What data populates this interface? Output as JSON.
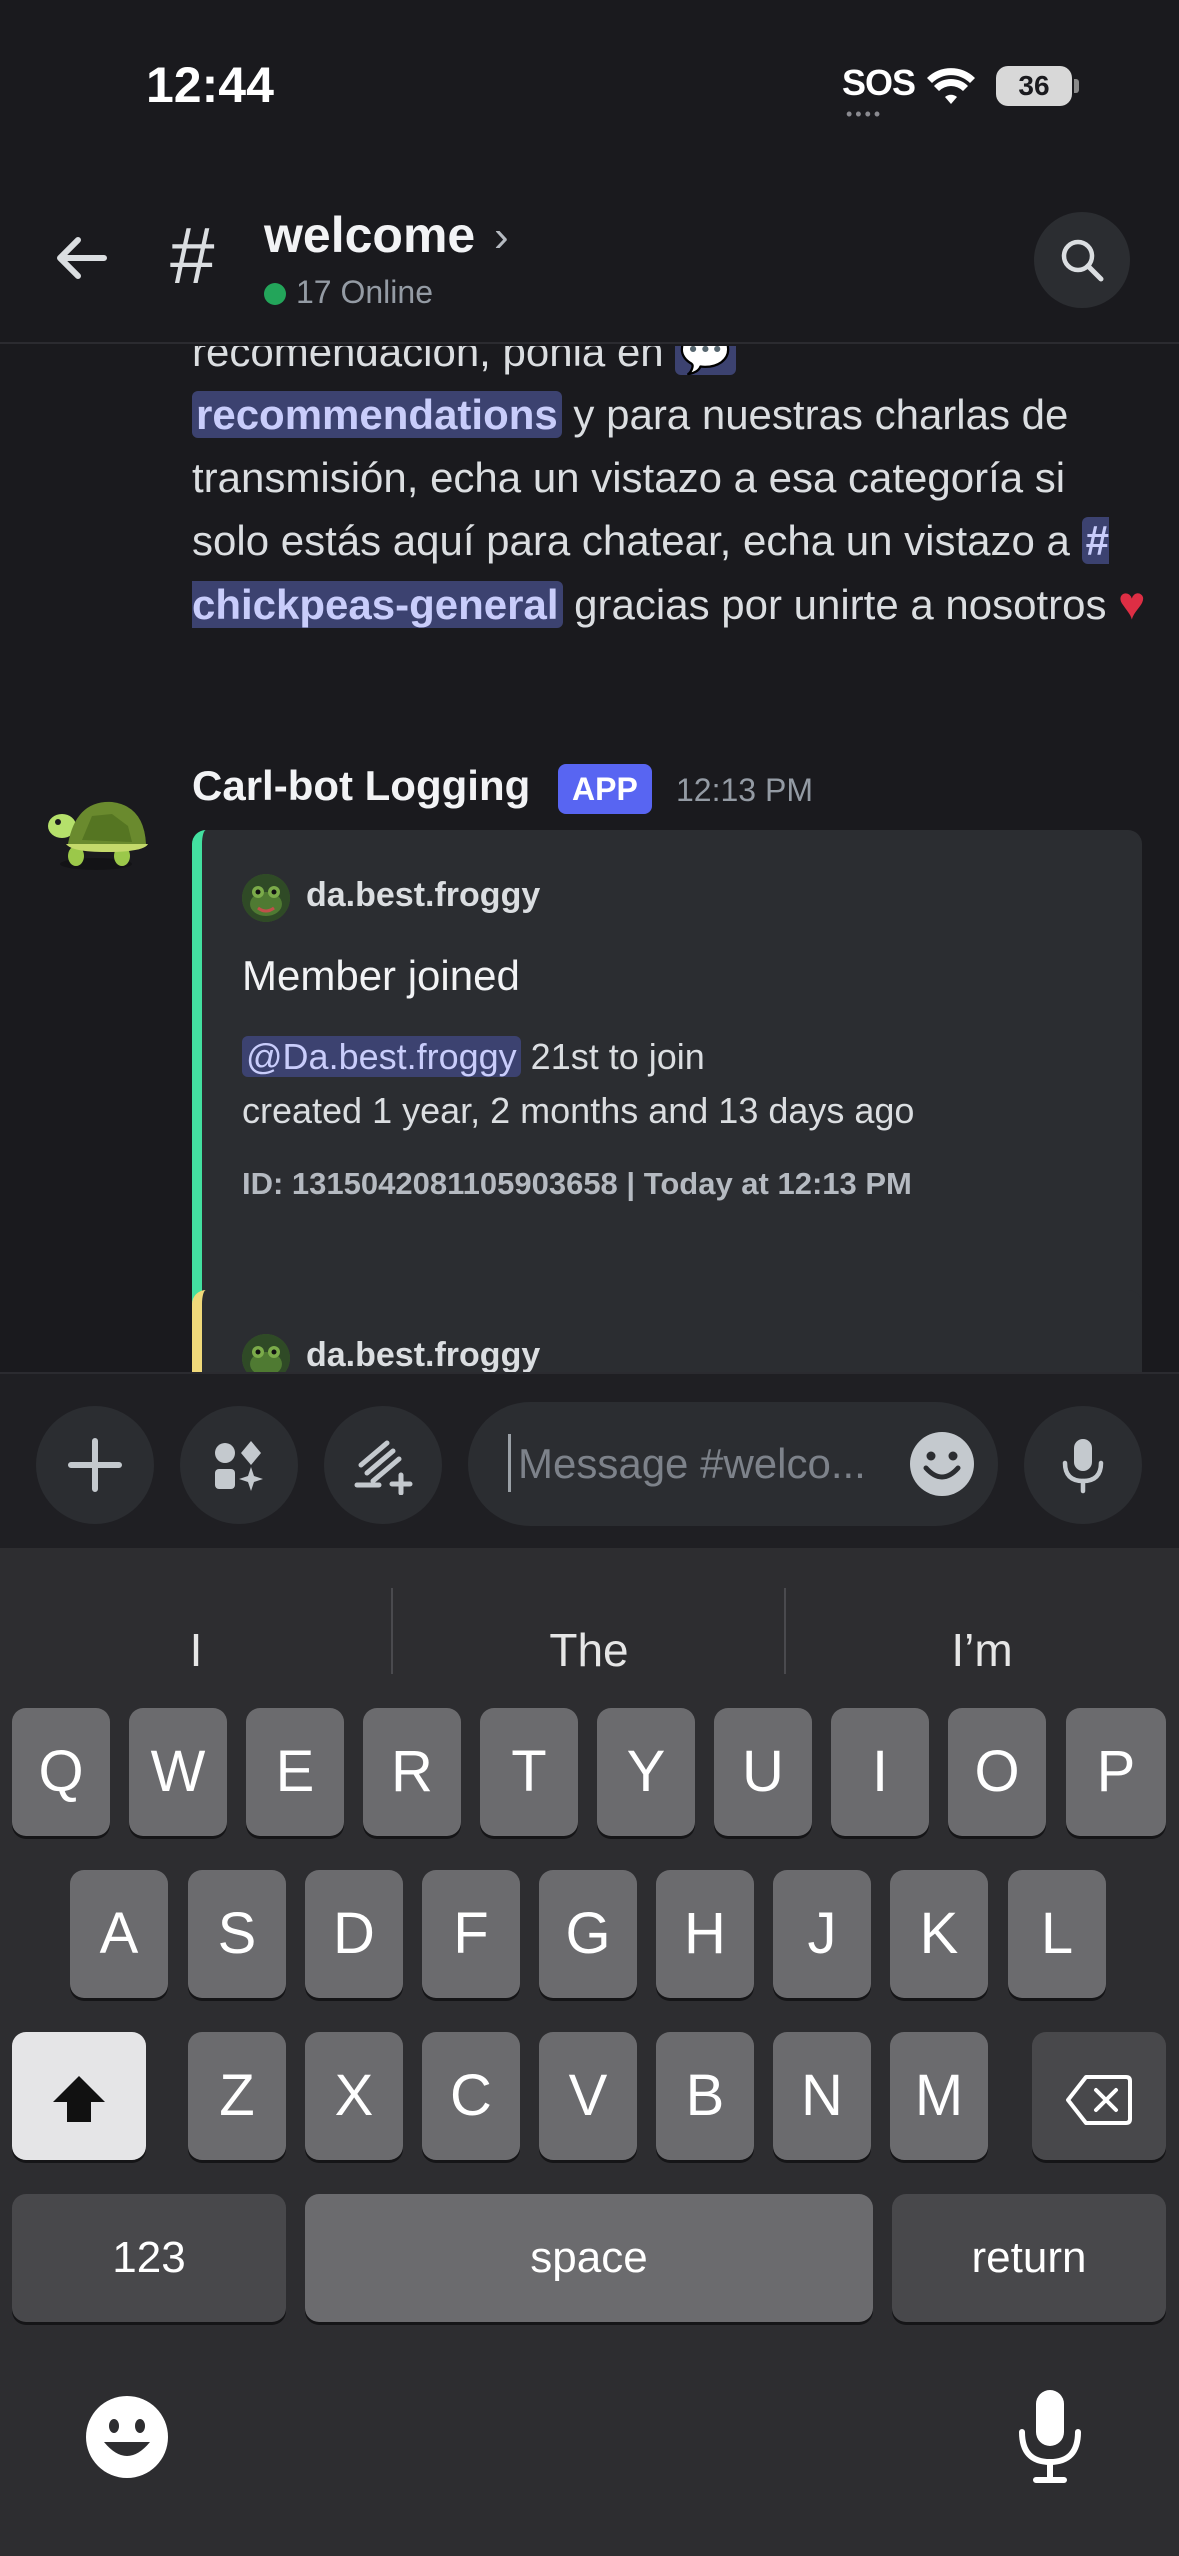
{
  "status_bar": {
    "time": "12:44",
    "sos": "SOS",
    "battery": "36"
  },
  "header": {
    "channel_name": "welcome",
    "online": "17 Online",
    "hash_icon": "#",
    "chevron": "›"
  },
  "messages": {
    "prev_text_1": "recomendación, ponla en",
    "mention_recommendations": "recommendations",
    "prev_text_2": " y para nuestras charlas de transmisión, echa un vistazo a esa categoría si solo estás aquí para chatear, echa un vistazo a ",
    "mention_general": "# chickpeas-general",
    "prev_text_3": " gracias por unirte a nosotros ",
    "heart": "♥",
    "bot_message": {
      "author": "Carl-bot Logging",
      "badge": "APP",
      "timestamp": "12:13 PM",
      "embed": {
        "author": "da.best.froggy",
        "title": "Member joined",
        "mention": "@Da.best.froggy",
        "desc_1": " 21st to join",
        "desc_2": "created 1 year, 2 months and 13 days ago",
        "footer": "ID: 1315042081105903658 | Today at 12:13 PM"
      },
      "embed2_author": "da.best.froggy"
    }
  },
  "composer": {
    "placeholder": "Message #welco..."
  },
  "keyboard": {
    "suggestions": [
      "I",
      "The",
      "I’m"
    ],
    "row1": [
      "Q",
      "W",
      "E",
      "R",
      "T",
      "Y",
      "U",
      "I",
      "O",
      "P"
    ],
    "row2": [
      "A",
      "S",
      "D",
      "F",
      "G",
      "H",
      "J",
      "K",
      "L"
    ],
    "row3": [
      "Z",
      "X",
      "C",
      "V",
      "B",
      "N",
      "M"
    ],
    "numbers_key": "123",
    "space_key": "space",
    "return_key": "return"
  },
  "colors": {
    "background": "#1a1a1e",
    "accent": "#5865f2",
    "online": "#23a55a",
    "embed_bar_1": "#43e0a0",
    "embed_bar_2": "#f0d97a",
    "mention_bg": "#3c4270"
  }
}
